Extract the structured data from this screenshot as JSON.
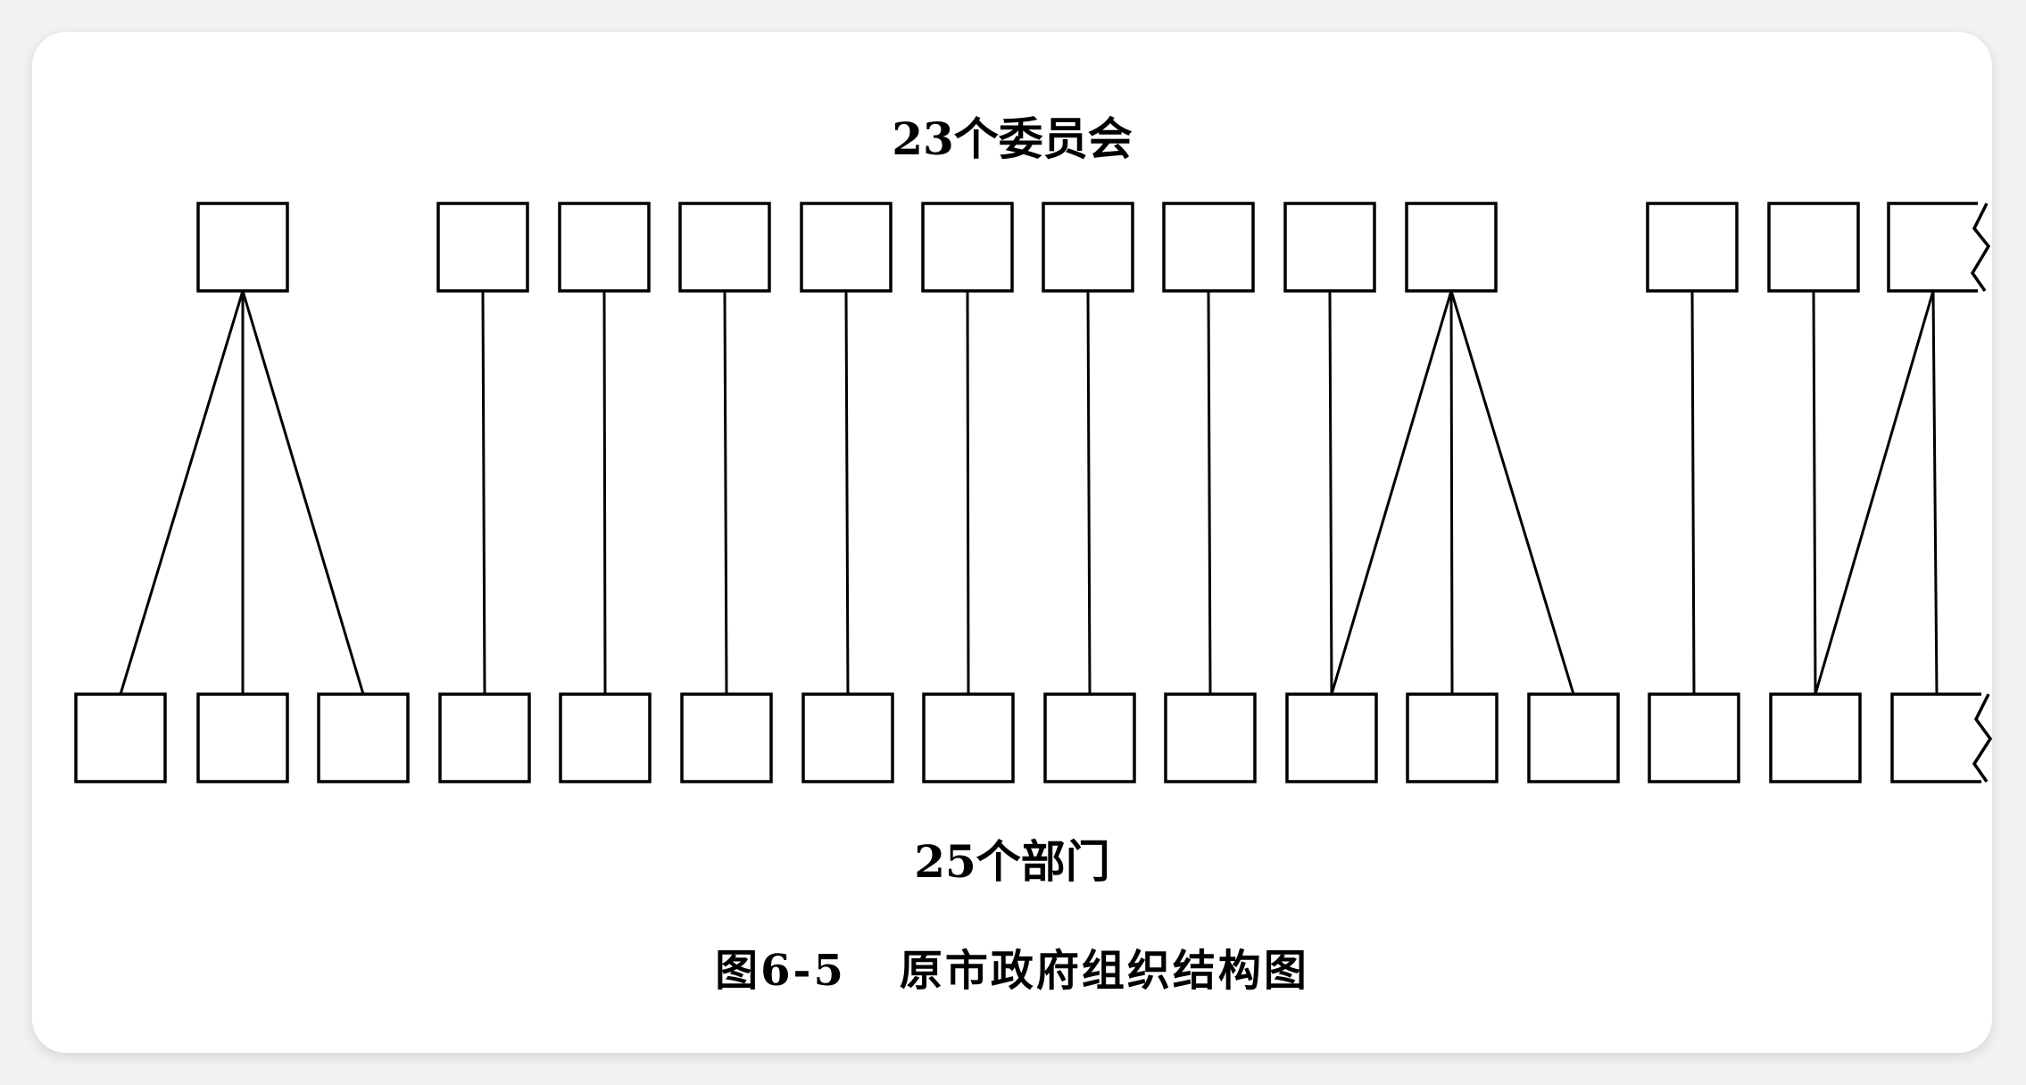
{
  "diagram": {
    "top_label": "23个委员会",
    "bottom_label": "25个部门",
    "caption_number": "图6-5",
    "caption_title": "原市政府组织结构图",
    "committee_count_visible": 13,
    "department_count_visible": 16,
    "links": [
      [
        0,
        0
      ],
      [
        0,
        1
      ],
      [
        0,
        2
      ],
      [
        1,
        3
      ],
      [
        2,
        4
      ],
      [
        3,
        5
      ],
      [
        4,
        6
      ],
      [
        5,
        7
      ],
      [
        6,
        8
      ],
      [
        7,
        9
      ],
      [
        8,
        10
      ],
      [
        9,
        10
      ],
      [
        9,
        11
      ],
      [
        9,
        12
      ],
      [
        10,
        13
      ],
      [
        11,
        14
      ],
      [
        12,
        14
      ],
      [
        12,
        15
      ]
    ],
    "colors": {
      "line": "#000000",
      "box": "#000000",
      "background": "#ffffff"
    }
  }
}
